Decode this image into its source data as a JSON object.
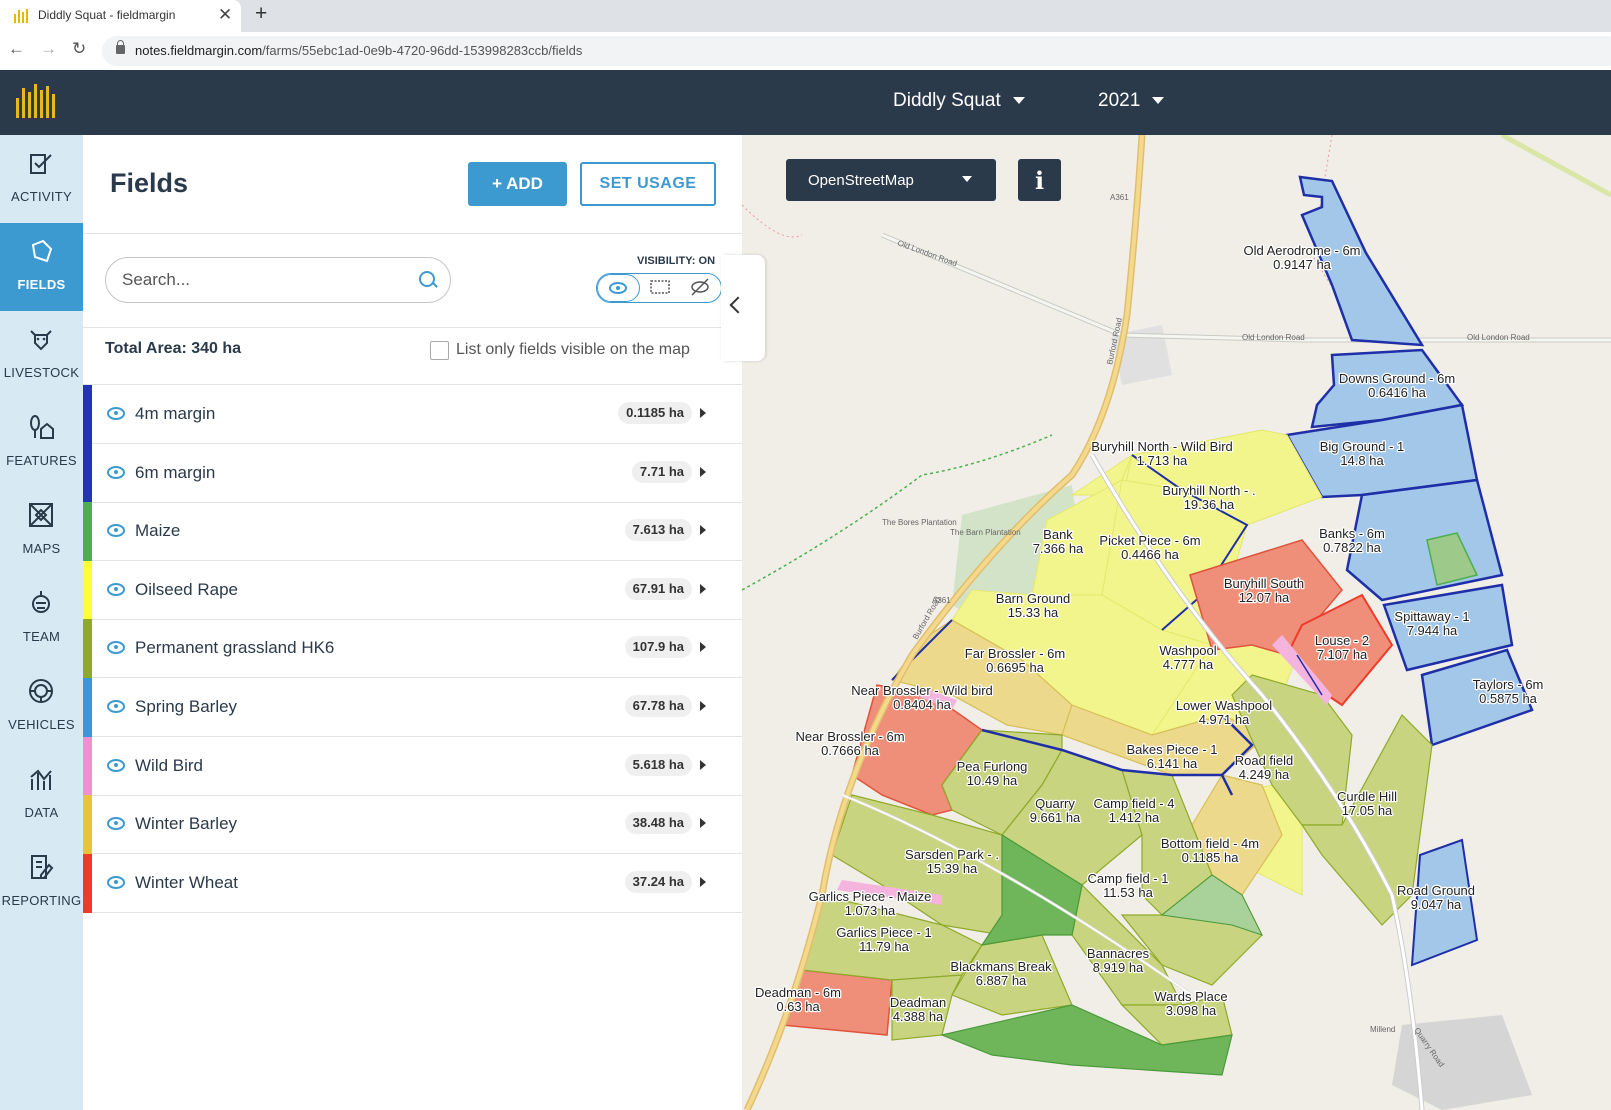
{
  "browser": {
    "tab_title": "Diddly Squat - fieldmargin",
    "url_host": "notes.fieldmargin.com",
    "url_path": "/farms/55ebc1ad-0e9b-4720-96dd-153998283ccb/fields"
  },
  "header": {
    "farm": "Diddly Squat",
    "year": "2021"
  },
  "sidebar": {
    "items": [
      {
        "label": "ACTIVITY",
        "icon": "activity-icon"
      },
      {
        "label": "FIELDS",
        "icon": "fields-icon",
        "active": true
      },
      {
        "label": "LIVESTOCK",
        "icon": "livestock-icon"
      },
      {
        "label": "FEATURES",
        "icon": "features-icon"
      },
      {
        "label": "MAPS",
        "icon": "maps-icon"
      },
      {
        "label": "TEAM",
        "icon": "team-icon"
      },
      {
        "label": "VEHICLES",
        "icon": "vehicles-icon"
      },
      {
        "label": "DATA",
        "icon": "data-icon"
      },
      {
        "label": "REPORTING",
        "icon": "reporting-icon"
      }
    ]
  },
  "panel": {
    "title": "Fields",
    "add_label": "+ ADD",
    "set_usage_label": "SET USAGE",
    "search_placeholder": "Search...",
    "visibility_label": "VISIBILITY: ON",
    "total_area": "Total Area: 340 ha",
    "list_visible_label": "List only fields visible on the map",
    "fields": [
      {
        "name": "4m margin",
        "area": "0.1185 ha",
        "color": "#2432b8"
      },
      {
        "name": "6m margin",
        "area": "7.71 ha",
        "color": "#2432b8"
      },
      {
        "name": "Maize",
        "area": "7.613 ha",
        "color": "#4caf50"
      },
      {
        "name": "Oilseed Rape",
        "area": "67.91 ha",
        "color": "#ffff33"
      },
      {
        "name": "Permanent grassland HK6",
        "area": "107.9 ha",
        "color": "#8faa2a"
      },
      {
        "name": "Spring Barley",
        "area": "67.78 ha",
        "color": "#3d95db"
      },
      {
        "name": "Wild Bird",
        "area": "5.618 ha",
        "color": "#f28fd0"
      },
      {
        "name": "Winter Barley",
        "area": "38.48 ha",
        "color": "#ebc23c"
      },
      {
        "name": "Winter Wheat",
        "area": "37.24 ha",
        "color": "#f03a2a"
      }
    ]
  },
  "map": {
    "layer": "OpenStreetMap",
    "info_label": "i",
    "roads": [
      "A361",
      "Burford Road",
      "Old London Road",
      "Burford Road",
      "A361",
      "Old London Road",
      "Old London Road",
      "The Bores Plantation",
      "The Barn Plantation",
      "Millend",
      "Quarry Road"
    ],
    "labels": [
      {
        "name": "Old Aerodrome - 6m",
        "area": "0.9147 ha"
      },
      {
        "name": "Downs Ground - 6m",
        "area": "0.6416 ha"
      },
      {
        "name": "Big Ground - 1",
        "area": "14.8 ha"
      },
      {
        "name": "Buryhill North - Wild Bird",
        "area": "1.713 ha"
      },
      {
        "name": "Buryhill North - .",
        "area": "19.36 ha"
      },
      {
        "name": "Banks - 6m",
        "area": "0.7822 ha"
      },
      {
        "name": "Bank",
        "area": "7.366 ha"
      },
      {
        "name": "Picket Piece - 6m",
        "area": "0.4466 ha"
      },
      {
        "name": "Buryhill South",
        "area": "12.07 ha"
      },
      {
        "name": "Barn Ground",
        "area": "15.33 ha"
      },
      {
        "name": "Spittaway - 1",
        "area": "7.944 ha"
      },
      {
        "name": "Louse - 2",
        "area": "7.107 ha"
      },
      {
        "name": "Far Brossler - 6m",
        "area": "0.6695 ha"
      },
      {
        "name": "Washpool",
        "area": "4.777 ha"
      },
      {
        "name": "Taylors - 6m",
        "area": "0.5875 ha"
      },
      {
        "name": "Near Brossler - Wild bird",
        "area": "0.8404 ha"
      },
      {
        "name": "Lower Washpool",
        "area": "4.971 ha"
      },
      {
        "name": "Near Brossler - 6m",
        "area": "0.7666 ha"
      },
      {
        "name": "Bakes Piece - 1",
        "area": "6.141 ha"
      },
      {
        "name": "Pea Furlong",
        "area": "10.49 ha"
      },
      {
        "name": "Road field",
        "area": "4.249 ha"
      },
      {
        "name": "Curdle Hill",
        "area": "17.05 ha"
      },
      {
        "name": "Quarry",
        "area": "9.661 ha"
      },
      {
        "name": "Camp field - 4",
        "area": "1.412 ha"
      },
      {
        "name": "Bottom field - 4m",
        "area": "0.1185 ha"
      },
      {
        "name": "Sarsden Park - .",
        "area": "15.39 ha"
      },
      {
        "name": "Camp field - 1",
        "area": "11.53 ha"
      },
      {
        "name": "Road Ground",
        "area": "9.047 ha"
      },
      {
        "name": "Garlics Piece - Maize",
        "area": "1.073 ha"
      },
      {
        "name": "Garlics Piece - 1",
        "area": "11.79 ha"
      },
      {
        "name": "Bannacres",
        "area": "8.919 ha"
      },
      {
        "name": "Blackmans Break",
        "area": "6.887 ha"
      },
      {
        "name": "Deadman - 6m",
        "area": "0.63 ha"
      },
      {
        "name": "Wards Place",
        "area": "3.098 ha"
      },
      {
        "name": "Deadman",
        "area": "4.388 ha"
      }
    ]
  }
}
